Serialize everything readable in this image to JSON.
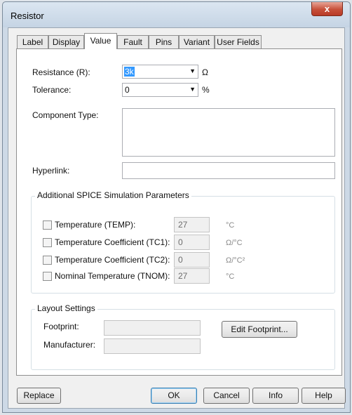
{
  "window": {
    "title": "Resistor",
    "close_symbol": "x"
  },
  "tabs": [
    {
      "label": "Label"
    },
    {
      "label": "Display"
    },
    {
      "label": "Value",
      "active": true
    },
    {
      "label": "Fault"
    },
    {
      "label": "Pins"
    },
    {
      "label": "Variant"
    },
    {
      "label": "User Fields"
    }
  ],
  "value_tab": {
    "resistance": {
      "label": "Resistance (R):",
      "value": "3k",
      "unit": "Ω"
    },
    "tolerance": {
      "label": "Tolerance:",
      "value": "0",
      "unit": "%"
    },
    "component_type": {
      "label": "Component Type:",
      "value": ""
    },
    "hyperlink": {
      "label": "Hyperlink:",
      "value": ""
    }
  },
  "spice": {
    "title": "Additional SPICE Simulation Parameters",
    "params": [
      {
        "label": "Temperature (TEMP):",
        "value": "27",
        "unit": "°C",
        "checked": false
      },
      {
        "label": "Temperature Coefficient (TC1):",
        "value": "0",
        "unit": "Ω/°C",
        "checked": false
      },
      {
        "label": "Temperature Coefficient (TC2):",
        "value": "0",
        "unit": "Ω/°C²",
        "checked": false
      },
      {
        "label": "Nominal Temperature (TNOM):",
        "value": "27",
        "unit": "°C",
        "checked": false
      }
    ]
  },
  "layout": {
    "title": "Layout Settings",
    "footprint_label": "Footprint:",
    "footprint_value": "",
    "manufacturer_label": "Manufacturer:",
    "manufacturer_value": "",
    "edit_footprint_label": "Edit Footprint..."
  },
  "buttons": {
    "replace": "Replace",
    "ok": "OK",
    "cancel": "Cancel",
    "info": "Info",
    "help": "Help"
  },
  "colors": {
    "selection": "#3399ff",
    "close_button": "#c7503a"
  }
}
